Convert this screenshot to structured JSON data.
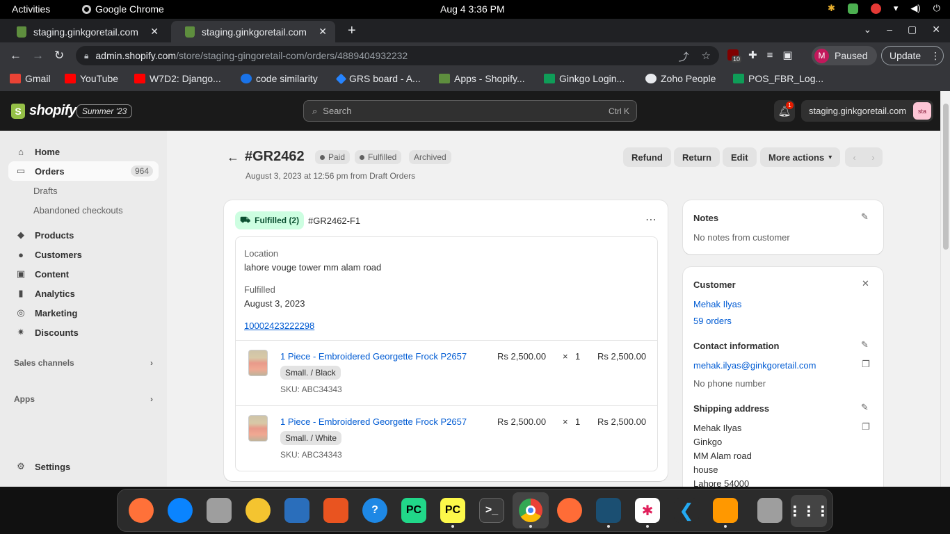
{
  "system": {
    "activities": "Activities",
    "app_name": "Google Chrome",
    "clock": "Aug 4  3:36 PM"
  },
  "browser": {
    "tabs": [
      {
        "title": "staging.ginkgoretail.com"
      },
      {
        "title": "staging.ginkgoretail.com"
      }
    ],
    "url_host": "admin.shopify.com",
    "url_path": "/store/staging-gingoretail-com/orders/4889404932232",
    "extension_badge": "10",
    "profile_initial": "M",
    "profile_status": "Paused",
    "update_label": "Update",
    "bookmarks": [
      {
        "label": "Gmail",
        "color": "#ea4335"
      },
      {
        "label": "YouTube",
        "color": "#ff0000"
      },
      {
        "label": "W7D2: Django...",
        "color": "#ff0000"
      },
      {
        "label": "code similarity",
        "color": "#1a73e8"
      },
      {
        "label": "GRS board - A...",
        "color": "#2684ff"
      },
      {
        "label": "Apps - Shopify...",
        "color": "#5e8e3e"
      },
      {
        "label": "Ginkgo Login...",
        "color": "#0f9d58"
      },
      {
        "label": "Zoho People",
        "color": "#e8eaed"
      },
      {
        "label": "POS_FBR_Log...",
        "color": "#0f9d58"
      }
    ]
  },
  "shopify": {
    "logo": "shopify",
    "edition": "Summer '23",
    "search_placeholder": "Search",
    "search_shortcut": "Ctrl K",
    "notif_count": "1",
    "store_name": "staging.ginkgoretail.com",
    "store_avatar": "sta"
  },
  "sidebar": {
    "home": "Home",
    "orders": "Orders",
    "orders_count": "964",
    "drafts": "Drafts",
    "abandoned": "Abandoned checkouts",
    "products": "Products",
    "customers": "Customers",
    "content": "Content",
    "analytics": "Analytics",
    "marketing": "Marketing",
    "discounts": "Discounts",
    "sales_channels": "Sales channels",
    "apps": "Apps",
    "settings": "Settings"
  },
  "order": {
    "number": "#GR2462",
    "badges": [
      "Paid",
      "Fulfilled",
      "Archived"
    ],
    "subtitle": "August 3, 2023 at 12:56 pm from Draft Orders",
    "actions": {
      "refund": "Refund",
      "return": "Return",
      "edit": "Edit",
      "more": "More actions"
    }
  },
  "fulfillment": {
    "status": "Fulfilled (2)",
    "id": "#GR2462-F1",
    "location_label": "Location",
    "location_value": "lahore vouge tower mm alam road",
    "fulfilled_label": "Fulfilled",
    "fulfilled_date": "August 3, 2023",
    "tracking": "10002423222298",
    "items": [
      {
        "name": "1 Piece - Embroidered Georgette Frock P2657",
        "variant": "Small. / Black",
        "sku": "SKU: ABC34343",
        "price": "Rs   2,500.00",
        "qty_sep": "×",
        "qty": "1",
        "total": "Rs 2,500.00"
      },
      {
        "name": "1 Piece - Embroidered Georgette Frock P2657",
        "variant": "Small. / White",
        "sku": "SKU: ABC34343",
        "price": "Rs   2,500.00",
        "qty_sep": "×",
        "qty": "1",
        "total": "Rs 2,500.00"
      }
    ]
  },
  "notes": {
    "title": "Notes",
    "text": "No notes from customer"
  },
  "customer": {
    "title": "Customer",
    "name": "Mehak Ilyas",
    "orders": "59 orders",
    "contact_title": "Contact information",
    "email": "mehak.ilyas@ginkgoretail.com",
    "phone": "No phone number",
    "shipping_title": "Shipping address",
    "address": [
      "Mehak Ilyas",
      "Ginkgo",
      "MM Alam road",
      "house",
      "Lahore 54000"
    ]
  },
  "dock": [
    "firefox",
    "thunderbird",
    "files",
    "rhythmbox",
    "writer",
    "app-center",
    "help",
    "pycharm",
    "pycharm-ce",
    "terminal",
    "chrome",
    "postman",
    "mysql-workbench",
    "slack",
    "vscode",
    "sublime-text",
    "trash",
    "show-apps"
  ]
}
